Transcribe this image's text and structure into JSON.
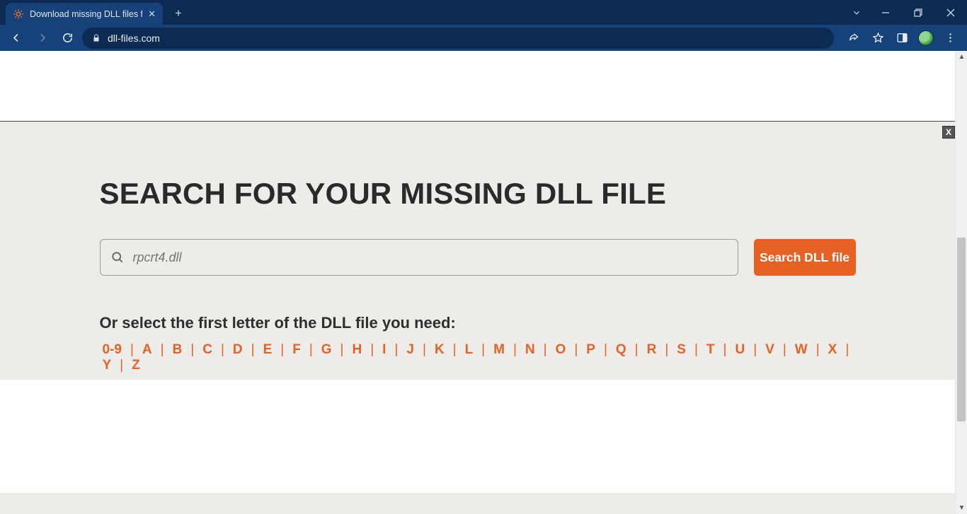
{
  "browser": {
    "tab_title": "Download missing DLL files for fr",
    "url": "dll-files.com"
  },
  "page": {
    "headline": "SEARCH FOR YOUR MISSING DLL FILE",
    "search_placeholder": "rpcrt4.dll",
    "search_button": "Search DLL file",
    "subheading": "Or select the first letter of the DLL file you need:",
    "letters": [
      "0-9",
      "A",
      "B",
      "C",
      "D",
      "E",
      "F",
      "G",
      "H",
      "I",
      "J",
      "K",
      "L",
      "M",
      "N",
      "O",
      "P",
      "Q",
      "R",
      "S",
      "T",
      "U",
      "V",
      "W",
      "X",
      "Y",
      "Z"
    ],
    "ad_close": "X"
  }
}
